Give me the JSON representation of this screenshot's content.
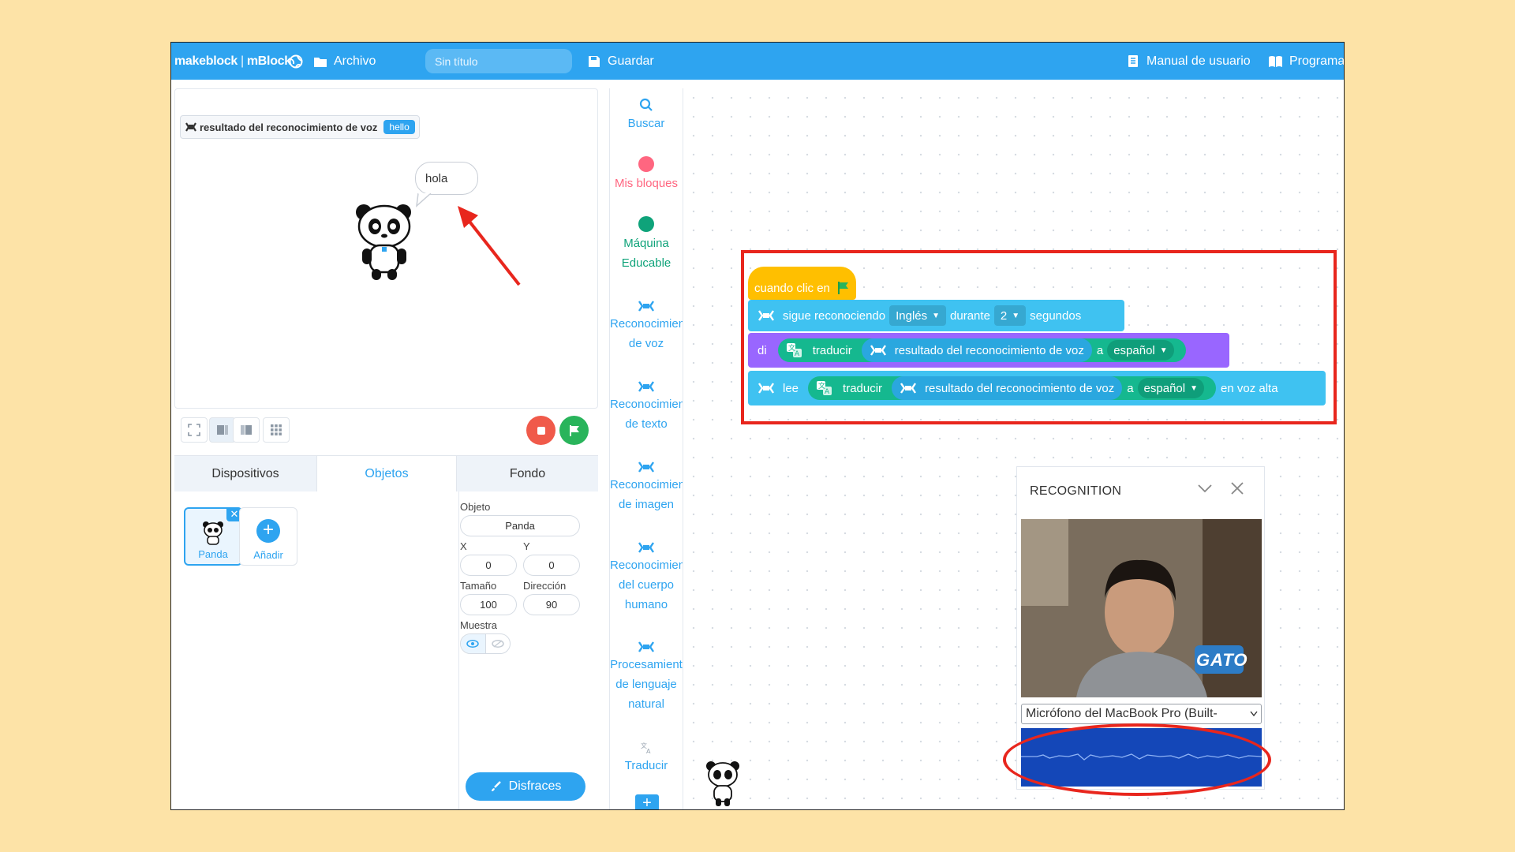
{
  "topbar": {
    "brand_left": "makeblock",
    "brand_sep": "|",
    "brand_right": "mBlock",
    "file_label": "Archivo",
    "project_title": "Sin título",
    "save_label": "Guardar",
    "manual_label": "Manual de usuario",
    "program_label": "Programa"
  },
  "stage": {
    "monitor_label": "resultado del reconocimiento de voz",
    "monitor_value": "hello",
    "speech_bubble": "hola"
  },
  "tabs": [
    {
      "label": "Dispositivos"
    },
    {
      "label": "Objetos"
    },
    {
      "label": "Fondo"
    }
  ],
  "sprites": {
    "items": [
      {
        "label": "Panda"
      },
      {
        "label": "Añadir"
      }
    ]
  },
  "props": {
    "object_label": "Objeto",
    "object_value": "Panda",
    "x_label": "X",
    "x_value": "0",
    "y_label": "Y",
    "y_value": "0",
    "size_label": "Tamaño",
    "size_value": "100",
    "direction_label": "Dirección",
    "direction_value": "90",
    "show_label": "Muestra",
    "costumes_label": "Disfraces"
  },
  "categories": [
    {
      "label": "Buscar"
    },
    {
      "label": "Mis bloques"
    },
    {
      "line1": "Máquina",
      "line2": "Educable"
    },
    {
      "line1": "Reconocimien",
      "line2": "de voz"
    },
    {
      "line1": "Reconocimien",
      "line2": "de texto"
    },
    {
      "line1": "Reconocimien",
      "line2": "de imagen"
    },
    {
      "line1": "Reconocimien",
      "line2": "del cuerpo",
      "line3": "humano"
    },
    {
      "line1": "Procesamient",
      "line2": "de lenguaje",
      "line3": "natural"
    },
    {
      "label": "Traducir"
    }
  ],
  "blocks": {
    "hat": "cuando clic en",
    "listen_prefix": "sigue reconociendo",
    "listen_lang": "Inglés",
    "listen_during": "durante",
    "listen_secs": "2",
    "listen_suffix": "segundos",
    "say": "di",
    "translate": "traducir",
    "speech_result": "resultado del reconocimiento de voz",
    "to": "a",
    "target_lang": "español",
    "read": "lee",
    "aloud": "en voz alta"
  },
  "recognition": {
    "title": "RECOGNITION",
    "mic_option": "Micrófono del MacBook Pro (Built-",
    "badge": "GATO"
  },
  "colors": {
    "topbar": "#2ea4f0",
    "hat_block": "#ffbf00",
    "speech_block": "#3fc2f1",
    "looks_block": "#9966ff",
    "translate_pill": "#15b88f",
    "highlight": "#e8261d",
    "wave_bg": "#1447b8"
  }
}
